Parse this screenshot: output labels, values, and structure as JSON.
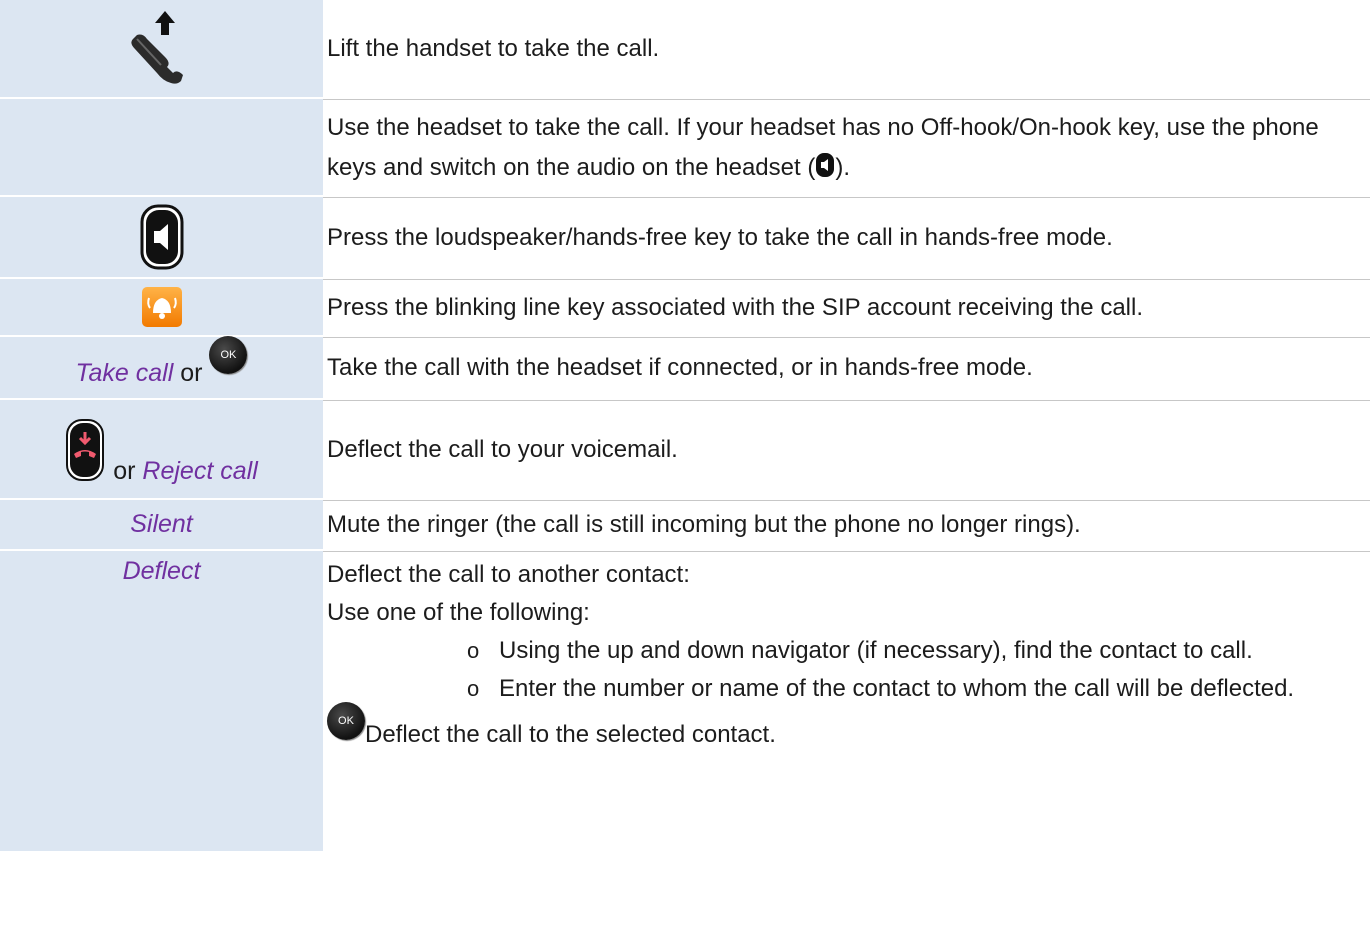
{
  "rows": [
    {
      "icon": "handset-lift-icon",
      "text": "Lift the handset to take the call."
    },
    {
      "text_part1": "Use the headset to take the call. If your headset has no Off-hook/On-hook key, use the phone keys and switch on the audio on the headset (",
      "text_part2": ")."
    },
    {
      "icon": "loudspeaker-key-icon",
      "text": "Press the loudspeaker/hands-free key to take the call in hands-free mode."
    },
    {
      "icon": "line-key-bell-icon",
      "text": "Press the blinking line key associated with the SIP account receiving the call."
    },
    {
      "softkey": "Take call",
      "or": "or",
      "ok_label": "OK",
      "text": "Take the call with the headset if connected, or in hands-free mode."
    },
    {
      "or": "or",
      "softkey": "Reject call",
      "text": "Deflect the call to your voicemail."
    },
    {
      "softkey": "Silent",
      "text": "Mute the ringer (the call is still incoming but the phone no longer rings)."
    },
    {
      "softkey": "Deflect",
      "text_line1": "Deflect the call to another contact:",
      "text_line2": "Use one of the following:",
      "bullet": "o",
      "sub_items": [
        "Using the up and down navigator (if necessary), find the contact to call.",
        "Enter the number or name of the contact to whom the call will be deflected."
      ],
      "ok_label": "OK",
      "final_text": "Deflect the call to the selected contact."
    }
  ]
}
